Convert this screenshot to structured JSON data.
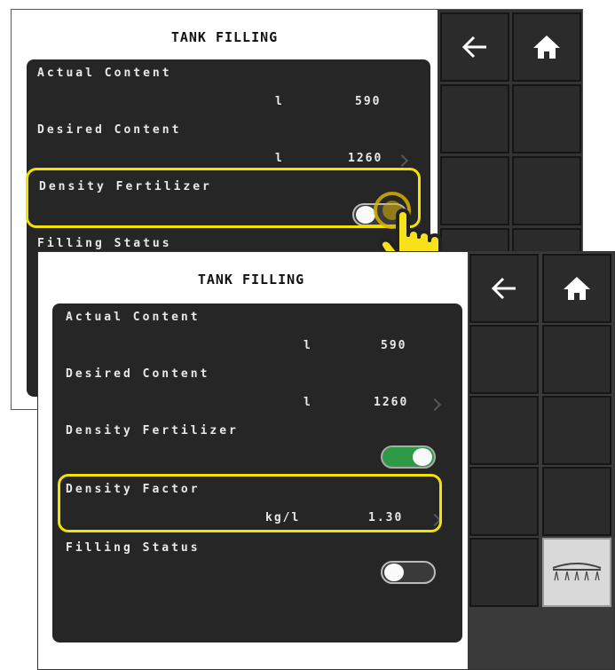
{
  "colors": {
    "highlight": "#f2e300",
    "toggle_on": "#2e9a45",
    "panel": "#262626"
  },
  "back_screen": {
    "title": "TANK FILLING",
    "rows": [
      {
        "label": "Actual Content",
        "unit": "l",
        "value": "590"
      },
      {
        "label": "Desired Content",
        "unit": "l",
        "value": "1260"
      },
      {
        "label": "Density Fertilizer",
        "toggle": "off"
      },
      {
        "label": "Filling Status",
        "toggle": "on"
      }
    ],
    "side_icons": [
      "back-arrow-icon",
      "home-icon"
    ]
  },
  "front_screen": {
    "title": "TANK FILLING",
    "rows": [
      {
        "label": "Actual Content",
        "unit": "l",
        "value": "590"
      },
      {
        "label": "Desired Content",
        "unit": "l",
        "value": "1260"
      },
      {
        "label": "Density Fertilizer",
        "toggle": "on"
      },
      {
        "label": "Density Factor",
        "unit": "kg/l",
        "value": "1.30"
      },
      {
        "label": "Filling Status",
        "toggle": "off"
      }
    ],
    "side_icons": [
      "back-arrow-icon",
      "home-icon",
      "sprayer-boom-icon"
    ]
  },
  "annotation": {
    "icon": "tapping-hand-icon"
  }
}
